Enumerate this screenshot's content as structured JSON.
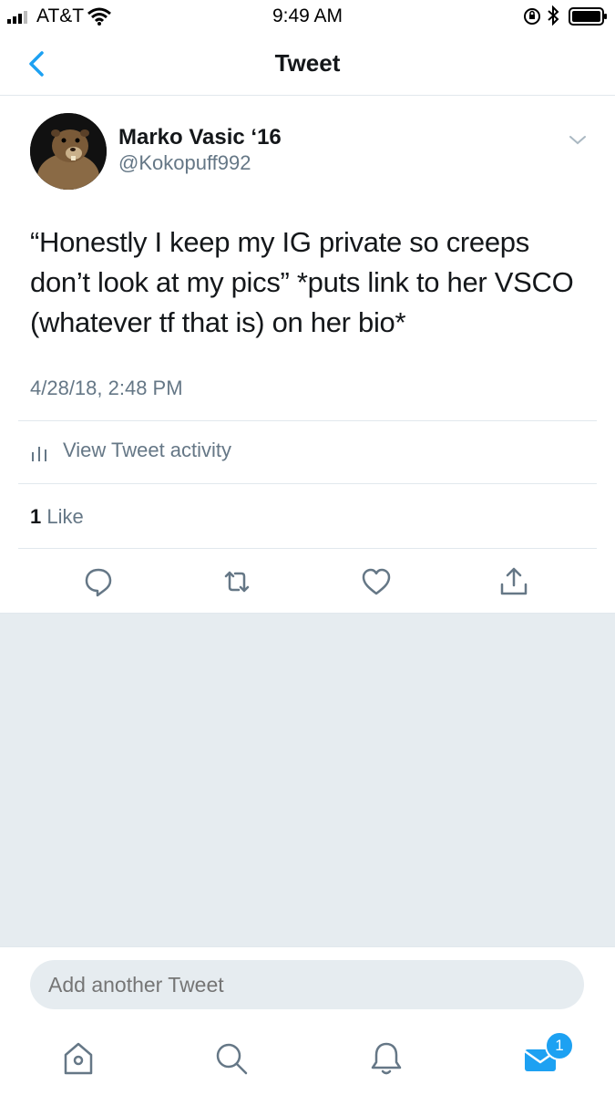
{
  "status_bar": {
    "carrier": "AT&T",
    "time": "9:49 AM"
  },
  "nav": {
    "title": "Tweet",
    "back_icon": "chevron-left-icon"
  },
  "tweet": {
    "author_name": "Marko Vasic ‘16",
    "author_handle": "@Kokopuff992",
    "text": "“Honestly I keep my IG private so creeps don’t look at my pics”  *puts link to her VSCO (whatever tf that is) on her bio*",
    "timestamp": "4/28/18, 2:48 PM",
    "activity_label": "View Tweet activity",
    "likes_count": "1",
    "likes_label": "Like"
  },
  "actions": [
    "reply-icon",
    "retweet-icon",
    "like-icon",
    "share-icon"
  ],
  "reply_box": {
    "placeholder": "Add another Tweet"
  },
  "tab_bar": {
    "tabs": [
      "home-icon",
      "search-icon",
      "notifications-icon",
      "messages-icon"
    ],
    "messages_badge": "1"
  },
  "colors": {
    "accent": "#1da1f2",
    "text": "#14171a",
    "secondary": "#657786",
    "gray_bg": "#e6ecf0",
    "border": "#e1e8ed"
  }
}
